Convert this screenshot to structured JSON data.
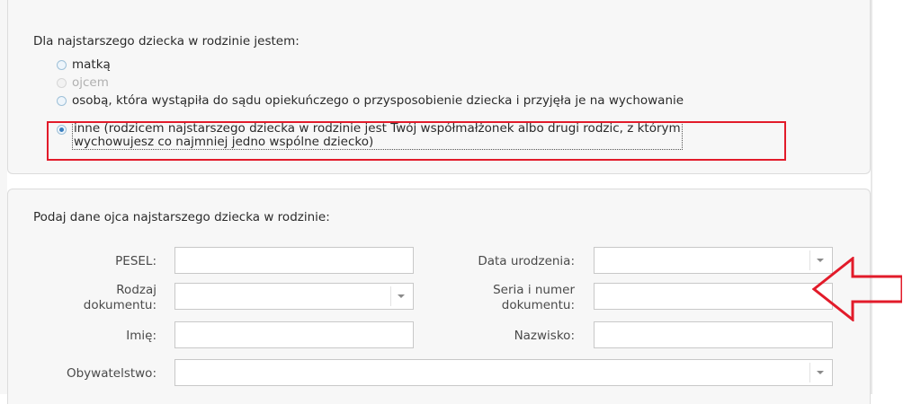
{
  "section1": {
    "question": "Dla najstarszego dziecka w rodzinie jestem:",
    "options": [
      {
        "label": "matką",
        "state": "unchecked"
      },
      {
        "label": "ojcem",
        "state": "disabled"
      },
      {
        "label": "osobą, która wystąpiła do sądu opiekuńczego o przysposobienie dziecka i przyjęła je na wychowanie",
        "state": "unchecked"
      },
      {
        "label_line1": "inne (rodzicem najstarszego dziecka w rodzinie jest Twój współmałżonek albo drugi rodzic, z którym",
        "label_line2": "wychowujesz co najmniej jedno wspólne dziecko)",
        "state": "checked"
      }
    ]
  },
  "section2": {
    "title": "Podaj dane ojca najstarszego dziecka w rodzinie:",
    "fields": {
      "pesel": {
        "label": "PESEL:",
        "value": ""
      },
      "birth_date": {
        "label": "Data urodzenia:",
        "value": ""
      },
      "doc_type": {
        "label_line1": "Rodzaj",
        "label_line2": "dokumentu:",
        "value": ""
      },
      "doc_number": {
        "label_line1": "Seria i numer",
        "label_line2": "dokumentu:",
        "value": ""
      },
      "first_name": {
        "label": "Imię:",
        "value": ""
      },
      "last_name": {
        "label": "Nazwisko:",
        "value": ""
      },
      "citizenship": {
        "label": "Obywatelstwo:",
        "value": ""
      }
    }
  },
  "colors": {
    "highlight": "#e21b2a",
    "panel_bg": "#f7f7f7",
    "radio_accent": "#3a7fc0"
  },
  "annotations": {
    "arrow_icon": "left-arrow-outline-icon"
  }
}
